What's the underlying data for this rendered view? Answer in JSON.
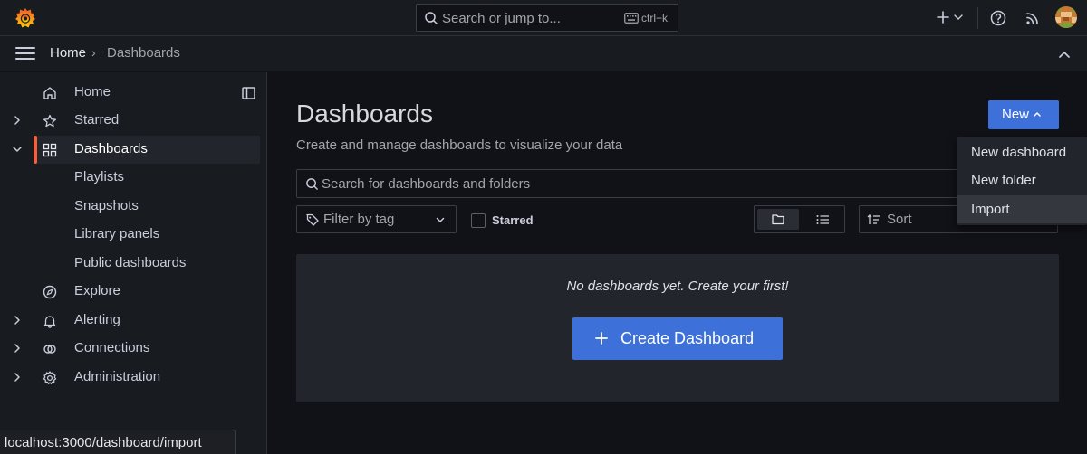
{
  "topbar": {
    "search_placeholder": "Search or jump to...",
    "search_shortcut": "ctrl+k"
  },
  "breadcrumb": {
    "home": "Home",
    "separator": "›",
    "current": "Dashboards"
  },
  "sidebar": {
    "items": [
      {
        "label": "Home",
        "icon": "home-icon"
      },
      {
        "label": "Starred",
        "icon": "star-icon"
      },
      {
        "label": "Dashboards",
        "icon": "apps-icon"
      },
      {
        "label": "Playlists"
      },
      {
        "label": "Snapshots"
      },
      {
        "label": "Library panels"
      },
      {
        "label": "Public dashboards"
      },
      {
        "label": "Explore",
        "icon": "compass-icon"
      },
      {
        "label": "Alerting",
        "icon": "bell-icon"
      },
      {
        "label": "Connections",
        "icon": "link-icon"
      },
      {
        "label": "Administration",
        "icon": "cog-icon"
      }
    ]
  },
  "main": {
    "title": "Dashboards",
    "subtitle": "Create and manage dashboards to visualize your data",
    "new_button": "New",
    "search_placeholder": "Search for dashboards and folders",
    "tag_filter": "Filter by tag",
    "starred_label": "Starred",
    "sort_label": "Sort",
    "empty_message": "No dashboards yet. Create your first!",
    "create_button": "Create Dashboard"
  },
  "new_menu": {
    "items": [
      "New dashboard",
      "New folder",
      "Import"
    ]
  },
  "status_bar": {
    "url": "localhost:3000/dashboard/import"
  },
  "colors": {
    "accent": "#3d71d9",
    "brand": "#f55f3e",
    "background": "#111217",
    "panel": "#181b1f"
  }
}
